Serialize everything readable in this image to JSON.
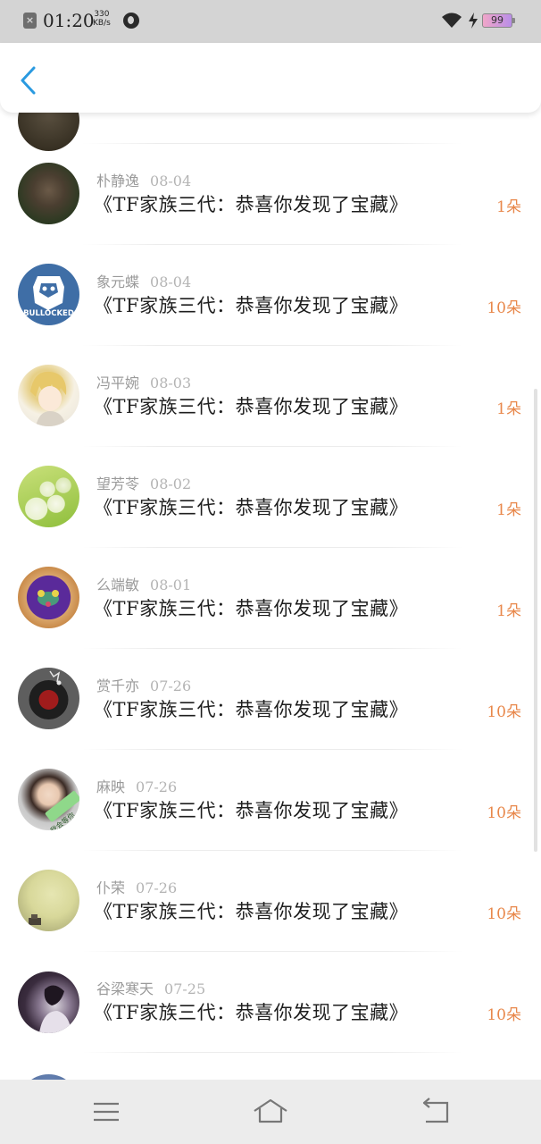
{
  "status_bar": {
    "time": "01:20",
    "speed_value": "330",
    "speed_unit": "KB/s",
    "battery": "99"
  },
  "header": {
    "back_icon": "chevron-left-icon"
  },
  "rows": [
    {
      "name": "",
      "date": "",
      "title": "",
      "amount": ""
    },
    {
      "name": "朴静逸",
      "date": "08-04",
      "title": "《TF家族三代：恭喜你发现了宝藏》",
      "amount": "1朵"
    },
    {
      "name": "象元蝶",
      "date": "08-04",
      "title": "《TF家族三代：恭喜你发现了宝藏》",
      "amount": "10朵"
    },
    {
      "name": "冯平婉",
      "date": "08-03",
      "title": "《TF家族三代：恭喜你发现了宝藏》",
      "amount": "1朵"
    },
    {
      "name": "望芳苓",
      "date": "08-02",
      "title": "《TF家族三代：恭喜你发现了宝藏》",
      "amount": "1朵"
    },
    {
      "name": "么端敏",
      "date": "08-01",
      "title": "《TF家族三代：恭喜你发现了宝藏》",
      "amount": "1朵"
    },
    {
      "name": "赏千亦",
      "date": "07-26",
      "title": "《TF家族三代：恭喜你发现了宝藏》",
      "amount": "10朵"
    },
    {
      "name": "麻映",
      "date": "07-26",
      "title": "《TF家族三代：恭喜你发现了宝藏》",
      "amount": "10朵"
    },
    {
      "name": "仆荣",
      "date": "07-26",
      "title": "《TF家族三代：恭喜你发现了宝藏》",
      "amount": "10朵"
    },
    {
      "name": "谷梁寒天",
      "date": "07-25",
      "title": "《TF家族三代：恭喜你发现了宝藏》",
      "amount": "10朵"
    },
    {
      "name": "",
      "date": "",
      "title": "",
      "amount": ""
    }
  ],
  "avatar_labels": {
    "bulldog": "BULLOCKED",
    "green_tag": "我会等你"
  },
  "colors": {
    "accent": "#2a9ae0",
    "amount": "#e8874a"
  },
  "nav_bar": {
    "menu_icon": "menu-icon",
    "home_icon": "home-icon",
    "back_icon": "back-arrow-icon"
  }
}
